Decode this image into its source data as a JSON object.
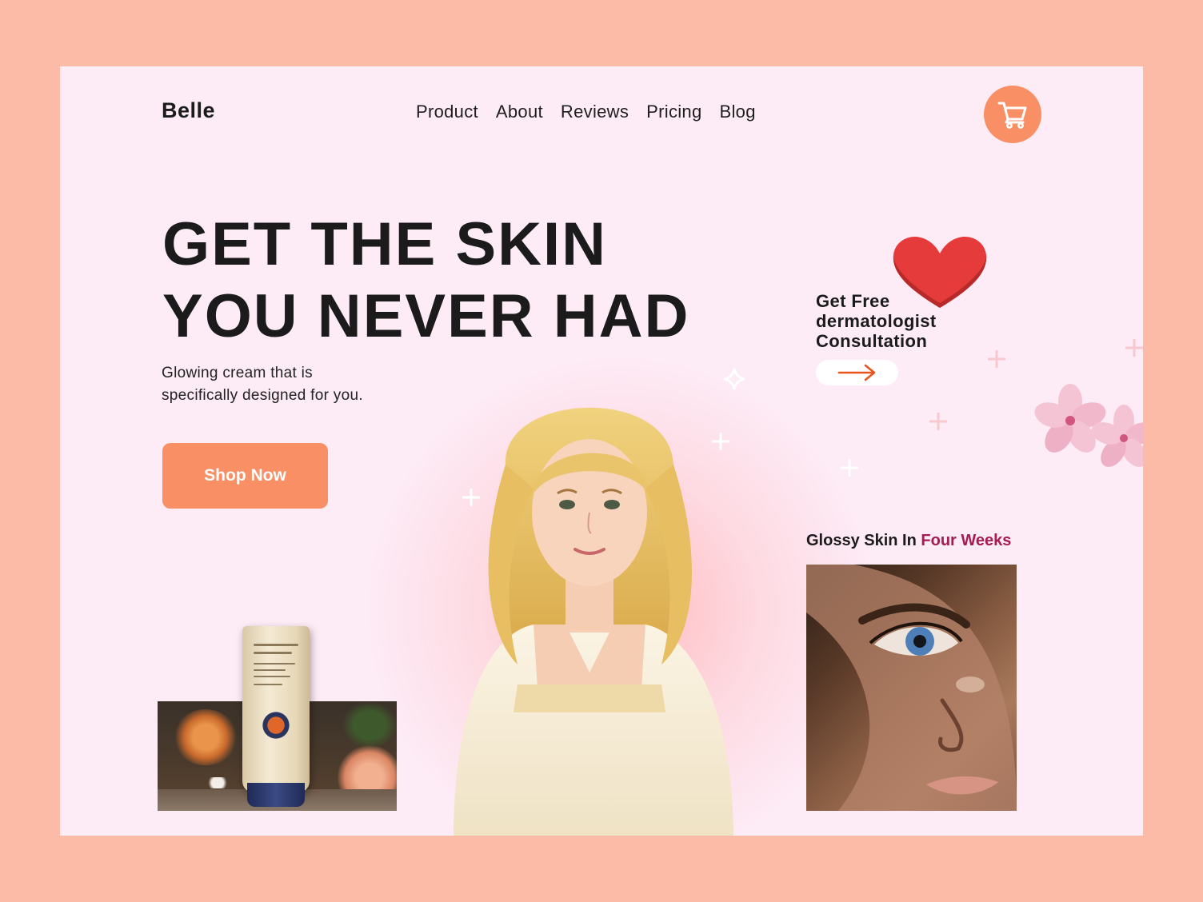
{
  "header": {
    "logo": "Belle",
    "nav": [
      "Product",
      "About",
      "Reviews",
      "Pricing",
      "Blog"
    ],
    "cart_icon": "cart-icon"
  },
  "hero": {
    "title_line1": "GET THE SKIN",
    "title_line2": "YOU NEVER HAD",
    "subtitle_line1": "Glowing cream that is",
    "subtitle_line2": "specifically designed for you.",
    "cta": "Shop Now"
  },
  "consultation": {
    "line1": "Get Free",
    "line2": "dermatologist",
    "line3": "Consultation",
    "arrow_icon": "arrow-right-icon"
  },
  "glossy": {
    "prefix": "Glossy Skin In ",
    "accent": "Four Weeks"
  },
  "colors": {
    "page_background": "#fbbba6",
    "card_background": "#fdebf6",
    "accent": "#f98f64",
    "heading": "#1b1b1b",
    "highlight": "#a61b52",
    "heart": "#e63b3b"
  }
}
